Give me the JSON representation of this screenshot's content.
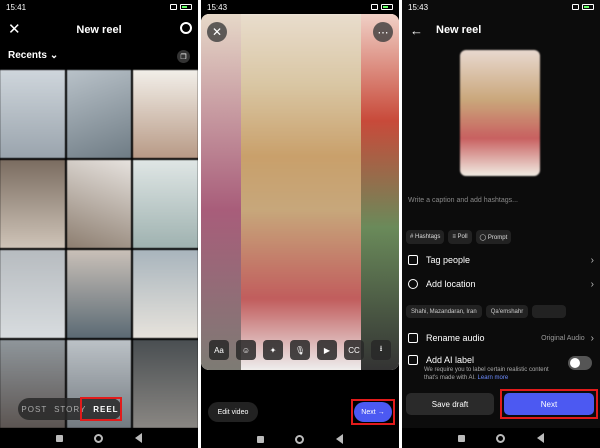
{
  "panel1": {
    "status": {
      "time": "15:41"
    },
    "header": {
      "title": "New reel"
    },
    "recents_label": "Recents",
    "modes": {
      "post": "POST",
      "story": "STORY",
      "reel": "REEL"
    }
  },
  "panel2": {
    "status": {
      "time": "15:43"
    },
    "tools": [
      "Aa",
      "☺",
      "✦",
      "🎙",
      "▶",
      "CC",
      "⭳"
    ],
    "edit_video": "Edit video",
    "next": "Next",
    "next_arrow": "→"
  },
  "panel3": {
    "status": {
      "time": "15:43"
    },
    "header": {
      "title": "New reel"
    },
    "caption_placeholder": "Write a caption and add hashtags...",
    "chips": [
      "# Hashtags",
      "≡ Poll",
      "◯ Prompt"
    ],
    "rows": {
      "tag_people": "Tag people",
      "add_location": "Add location",
      "rename_audio": "Rename audio",
      "original_audio": "Original Audio",
      "add_ai_label": "Add AI label"
    },
    "locations": [
      "Shahi, Mazandaran, Iran",
      "Qa'emshahr"
    ],
    "ai_description": "We require you to label certain realistic content that's made with AI.",
    "learn_more": "Learn more",
    "save_draft": "Save draft",
    "next": "Next"
  },
  "colors": {
    "accent": "#4c59f2",
    "highlight": "#e21b1b"
  }
}
